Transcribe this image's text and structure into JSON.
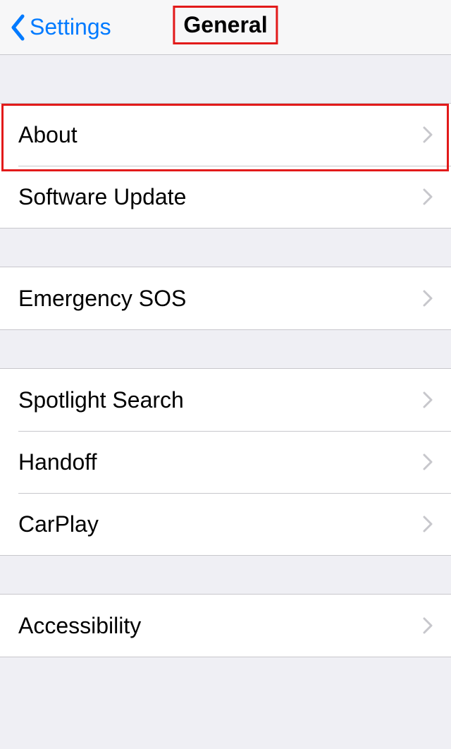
{
  "navbar": {
    "back_label": "Settings",
    "title": "General"
  },
  "groups": [
    {
      "rows": [
        {
          "id": "about",
          "label": "About"
        },
        {
          "id": "software-update",
          "label": "Software Update"
        }
      ]
    },
    {
      "rows": [
        {
          "id": "emergency-sos",
          "label": "Emergency SOS"
        }
      ]
    },
    {
      "rows": [
        {
          "id": "spotlight-search",
          "label": "Spotlight Search"
        },
        {
          "id": "handoff",
          "label": "Handoff"
        },
        {
          "id": "carplay",
          "label": "CarPlay"
        }
      ]
    },
    {
      "rows": [
        {
          "id": "accessibility",
          "label": "Accessibility"
        }
      ]
    }
  ],
  "colors": {
    "tint": "#007aff",
    "highlight": "#e21a1a",
    "bg": "#efeff4",
    "separator": "#c8c7cc"
  }
}
